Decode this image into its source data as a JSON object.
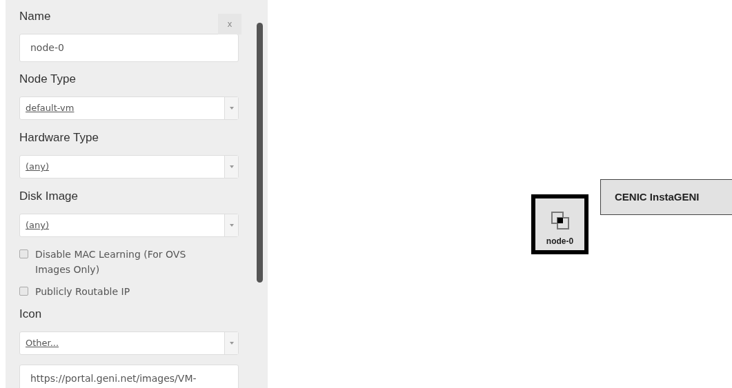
{
  "panel": {
    "close": "x",
    "fields": [
      {
        "kind": "text",
        "label": "Name",
        "value": "node-0"
      },
      {
        "kind": "select",
        "label": "Node Type",
        "value": "default-vm"
      },
      {
        "kind": "select",
        "label": "Hardware Type",
        "value": "(any)"
      },
      {
        "kind": "select",
        "label": "Disk Image",
        "value": "(any)"
      },
      {
        "kind": "checkbox",
        "label": "Disable MAC Learning (For OVS Images Only)",
        "checked": false
      },
      {
        "kind": "checkbox",
        "label": "Publicly Routable IP",
        "checked": false
      },
      {
        "kind": "select",
        "label": "Icon",
        "value": "Other..."
      },
      {
        "kind": "text",
        "value": "https://portal.geni.net/images/VM-"
      }
    ]
  },
  "canvas": {
    "node": {
      "label": "node-0"
    },
    "site": {
      "label": "CENIC InstaGENI"
    }
  }
}
